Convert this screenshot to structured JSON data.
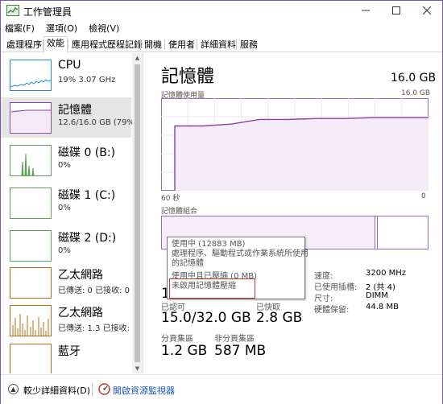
{
  "window": {
    "title": "工作管理員"
  },
  "menu": [
    "檔案(F)",
    "選項(O)",
    "檢視(V)"
  ],
  "tabs": [
    "處理程序",
    "效能",
    "應用程式歷程記錄",
    "開機",
    "使用者",
    "詳細資料",
    "服務"
  ],
  "active_tab": "效能",
  "sidebar": {
    "items": [
      {
        "title": "CPU",
        "sub": "19%  3.07 GHz"
      },
      {
        "title": "記憶體",
        "sub": "12.6/16.0 GB (79%)"
      },
      {
        "title": "磁碟 0 (B:)",
        "sub": "0%"
      },
      {
        "title": "磁碟 1 (C:)",
        "sub": "0%"
      },
      {
        "title": "磁碟 2 (D:)",
        "sub": "0%"
      },
      {
        "title": "乙太網路",
        "sub": "已傳送: 0 已接收: 0 K"
      },
      {
        "title": "乙太網路",
        "sub": "已傳送: 1.3 已接收: 0"
      },
      {
        "title": "藍牙",
        "sub": ""
      }
    ]
  },
  "main": {
    "title": "記憶體",
    "total": "16.0 GB",
    "usage_label": "記憶體使用量",
    "usage_max": "16.0 GB",
    "axis_left": "60 秒",
    "axis_right": "0",
    "composition_label": "記憶體組合",
    "stats": {
      "committed_value": "15.0/32.0 GB",
      "committed_label": "已認可",
      "cached_label": "已快取",
      "cached_value": "2.8 GB",
      "paged_label": "分頁集區",
      "paged_value": "1.2 GB",
      "nonpaged_label": "非分頁集區",
      "nonpaged_value": "587 MB"
    },
    "specs": [
      {
        "label": "速度:",
        "value": "3200 MHz"
      },
      {
        "label": "已使用插槽:",
        "value": "2 (共 4)"
      },
      {
        "label": "尺寸:",
        "value": "DIMM"
      },
      {
        "label": "硬體保留:",
        "value": "44.8 MB"
      }
    ],
    "usage_trend_fraction": [
      0.7,
      0.7,
      0.72,
      0.77,
      0.77,
      0.78,
      0.78,
      0.79,
      0.79,
      0.79
    ],
    "composition_fractions": {
      "in_use": 0.8,
      "modified": 0.01,
      "standby": 0.19
    }
  },
  "tooltip": {
    "line1": "使用中 (12883 MB)",
    "line2": "處理程序、驅動程式或作業系統所使用",
    "line3": "的記憶體",
    "line4": "使用中且已壓縮 (0 MB)",
    "line5": "未啟用記憶體壓縮"
  },
  "footer": {
    "fewer_details": "較少詳細資料(D)",
    "open_monitor": "開啟資源監視器"
  },
  "colors": {
    "accent": "#8e3fa8",
    "cpu": "#1d90c9",
    "disk": "#5fa05a",
    "net": "#b06f1e",
    "link": "#1a56c5"
  }
}
